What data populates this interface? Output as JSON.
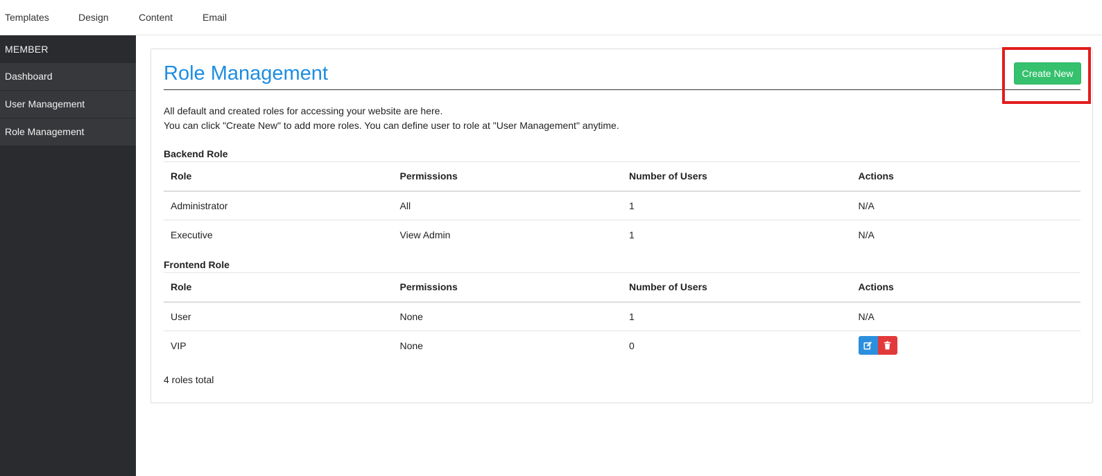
{
  "topnav": {
    "items": [
      {
        "label": "Templates"
      },
      {
        "label": "Design"
      },
      {
        "label": "Content"
      },
      {
        "label": "Email"
      }
    ]
  },
  "sidebar": {
    "heading": "MEMBER",
    "items": [
      {
        "label": "Dashboard"
      },
      {
        "label": "User Management"
      },
      {
        "label": "Role Management"
      }
    ]
  },
  "main": {
    "title": "Role Management",
    "create_label": "Create New",
    "intro_line1": "All default and created roles for accessing your website are here.",
    "intro_line2": "You can click \"Create New\" to add more roles. You can define user to role at \"User Management\" anytime.",
    "columns": [
      "Role",
      "Permissions",
      "Number of Users",
      "Actions"
    ],
    "backend": {
      "title": "Backend Role",
      "rows": [
        {
          "role": "Administrator",
          "permissions": "All",
          "users": "1",
          "actions": "N/A"
        },
        {
          "role": "Executive",
          "permissions": "View Admin",
          "users": "1",
          "actions": "N/A"
        }
      ]
    },
    "frontend": {
      "title": "Frontend Role",
      "rows": [
        {
          "role": "User",
          "permissions": "None",
          "users": "1",
          "actions": "N/A"
        },
        {
          "role": "VIP",
          "permissions": "None",
          "users": "0",
          "actions": ""
        }
      ]
    },
    "total": "4 roles total"
  },
  "colors": {
    "accent": "#1e8de0",
    "create_button": "#35c16d",
    "edit_button": "#2b8fde",
    "delete_button": "#e23a3a",
    "sidebar_bg": "#2a2b2e",
    "highlight": "#e31b1b"
  },
  "icons": {
    "edit": "edit-icon",
    "delete": "trash-icon"
  }
}
